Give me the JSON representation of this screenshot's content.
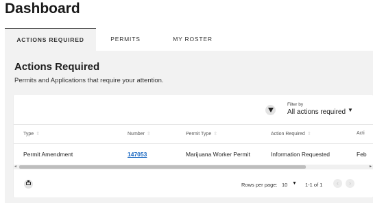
{
  "page": {
    "title": "Dashboard"
  },
  "tabs": [
    {
      "label": "ACTIONS REQUIRED",
      "active": true
    },
    {
      "label": "PERMITS",
      "active": false
    },
    {
      "label": "MY ROSTER",
      "active": false
    }
  ],
  "section": {
    "title": "Actions Required",
    "subtitle": "Permits and Applications that require your attention."
  },
  "filter": {
    "label": "Filter by",
    "value": "All actions required",
    "icon": "filter-icon"
  },
  "table": {
    "columns": [
      "Type",
      "Number",
      "Permit Type",
      "Action Required",
      "Acti"
    ],
    "rows": [
      [
        "Permit Amendment",
        "147053",
        "Marijuana Worker Permit",
        "Information Requested",
        "Feb"
      ]
    ]
  },
  "pagination": {
    "rows_per_page_label": "Rows per page:",
    "rows_per_page_value": "10",
    "range": "1-1 of 1"
  },
  "icons": {
    "print": "print-icon",
    "prev": "chevron-left-icon",
    "next": "chevron-right-icon",
    "sort": "sort-icon"
  },
  "colors": {
    "link": "#1565c0",
    "panel_bg": "#f2f2f2"
  }
}
